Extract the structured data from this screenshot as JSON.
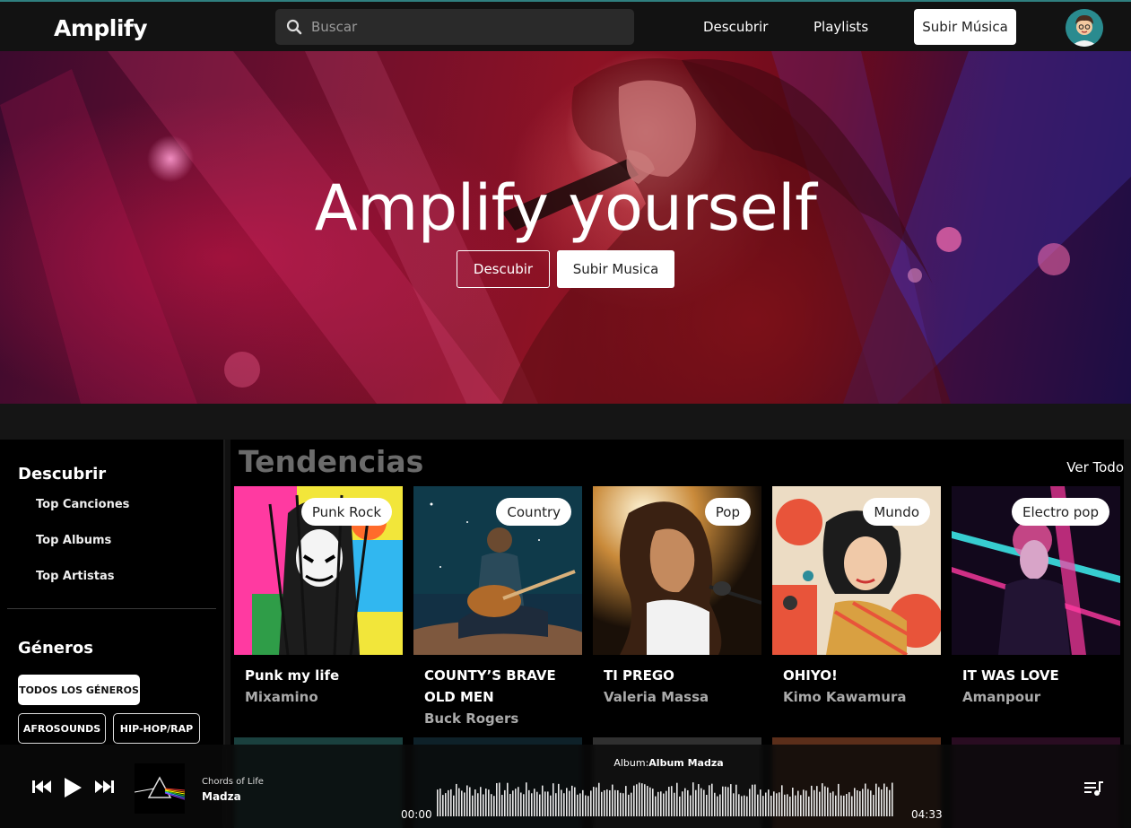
{
  "app": {
    "brand": "Amplify"
  },
  "search": {
    "placeholder": "Buscar"
  },
  "nav": {
    "discover": "Descubrir",
    "playlists": "Playlists",
    "upload": "Subir Música"
  },
  "hero": {
    "title": "Amplify yourself",
    "btn_discover": "Descubir",
    "btn_upload": "Subir Musica"
  },
  "sidebar": {
    "discover_heading": "Descubrir",
    "links": [
      "Top Canciones",
      "Top Albums",
      "Top Artistas"
    ],
    "genres_heading": "Géneros",
    "chips": [
      "TODOS LOS GÉNEROS",
      "AFROSOUNDS",
      "HIP-HOP/RAP"
    ]
  },
  "trending": {
    "title": "Tendencias",
    "see_all": "Ver Todo",
    "cards": [
      {
        "genre": "Punk Rock",
        "title": "Punk my life",
        "artist": "Mixamino"
      },
      {
        "genre": "Country",
        "title": "COUNTY’S BRAVE OLD MEN",
        "artist": "Buck Rogers"
      },
      {
        "genre": "Pop",
        "title": "TI PREGO",
        "artist": "Valeria Massa"
      },
      {
        "genre": "Mundo",
        "title": "OHIYO!",
        "artist": "Kimo Kawamura"
      },
      {
        "genre": "Electro pop",
        "title": "IT WAS LOVE",
        "artist": "Amanpour"
      }
    ]
  },
  "player": {
    "track_title": "Chords of Life",
    "artist": "Madza",
    "album_prefix": "Album:",
    "album_name": "Album Madza",
    "time_current": "00:00",
    "time_total": "04:33",
    "progress": 0
  },
  "icons": {
    "search": "search-icon",
    "previous": "skip-back-icon",
    "play": "play-icon",
    "next": "skip-forward-icon",
    "queue": "queue-icon"
  }
}
